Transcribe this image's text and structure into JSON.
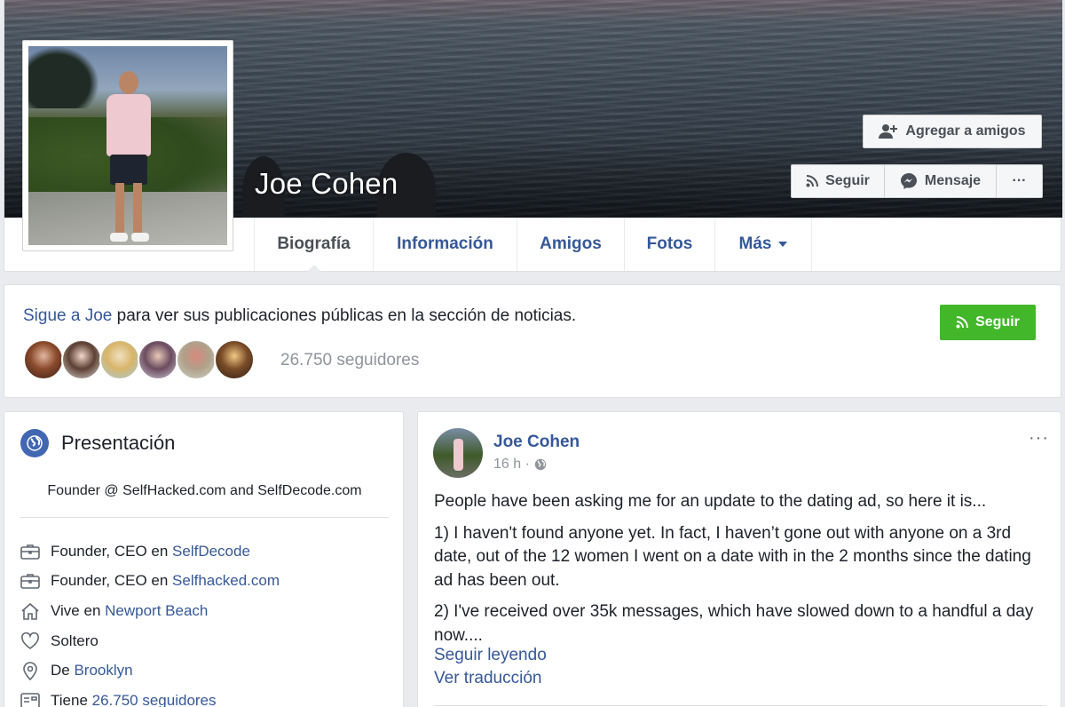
{
  "profile": {
    "name": "Joe Cohen"
  },
  "actions": {
    "add_friend": "Agregar a amigos",
    "follow": "Seguir",
    "message": "Mensaje",
    "more_dots": "···"
  },
  "tabs": [
    {
      "label": "Biografía"
    },
    {
      "label": "Información"
    },
    {
      "label": "Amigos"
    },
    {
      "label": "Fotos"
    },
    {
      "label": "Más"
    }
  ],
  "follow_card": {
    "link_text": "Sigue a Joe",
    "rest_text": " para ver sus publicaciones públicas en la sección de noticias.",
    "button": "Seguir",
    "followers": "26.750 seguidores"
  },
  "intro": {
    "title": "Presentación",
    "bio": "Founder @ SelfHacked.com and SelfDecode.com",
    "items": [
      {
        "icon": "briefcase-icon",
        "text": "Founder, CEO en ",
        "link": "SelfDecode"
      },
      {
        "icon": "briefcase-icon",
        "text": "Founder, CEO en ",
        "link": "Selfhacked.com"
      },
      {
        "icon": "home-icon",
        "text": "Vive en ",
        "link": "Newport Beach"
      },
      {
        "icon": "heart-icon",
        "text": "Soltero",
        "link": ""
      },
      {
        "icon": "location-pin-icon",
        "text": "De ",
        "link": "Brooklyn"
      },
      {
        "icon": "followers-icon",
        "text": "Tiene ",
        "link": "26.750 seguidores"
      }
    ]
  },
  "post": {
    "author": "Joe Cohen",
    "time": "16 h ·",
    "paragraphs": [
      "People have been asking me for an update to the dating ad, so here it is...",
      "1) I haven't found anyone yet. In fact, I haven’t gone out with anyone on a 3rd date, out of the 12 women I went on a date with in the 2 months since the dating ad has been out.",
      "2) I've received over 35k messages, which have slowed down to a handful a day now...."
    ],
    "read_more": "Seguir leyendo",
    "translate": "Ver traducción",
    "options": "···"
  },
  "colors": {
    "link": "#365899",
    "green": "#42b72a",
    "background": "#e9ebee",
    "brand_blue": "#4267b2"
  }
}
